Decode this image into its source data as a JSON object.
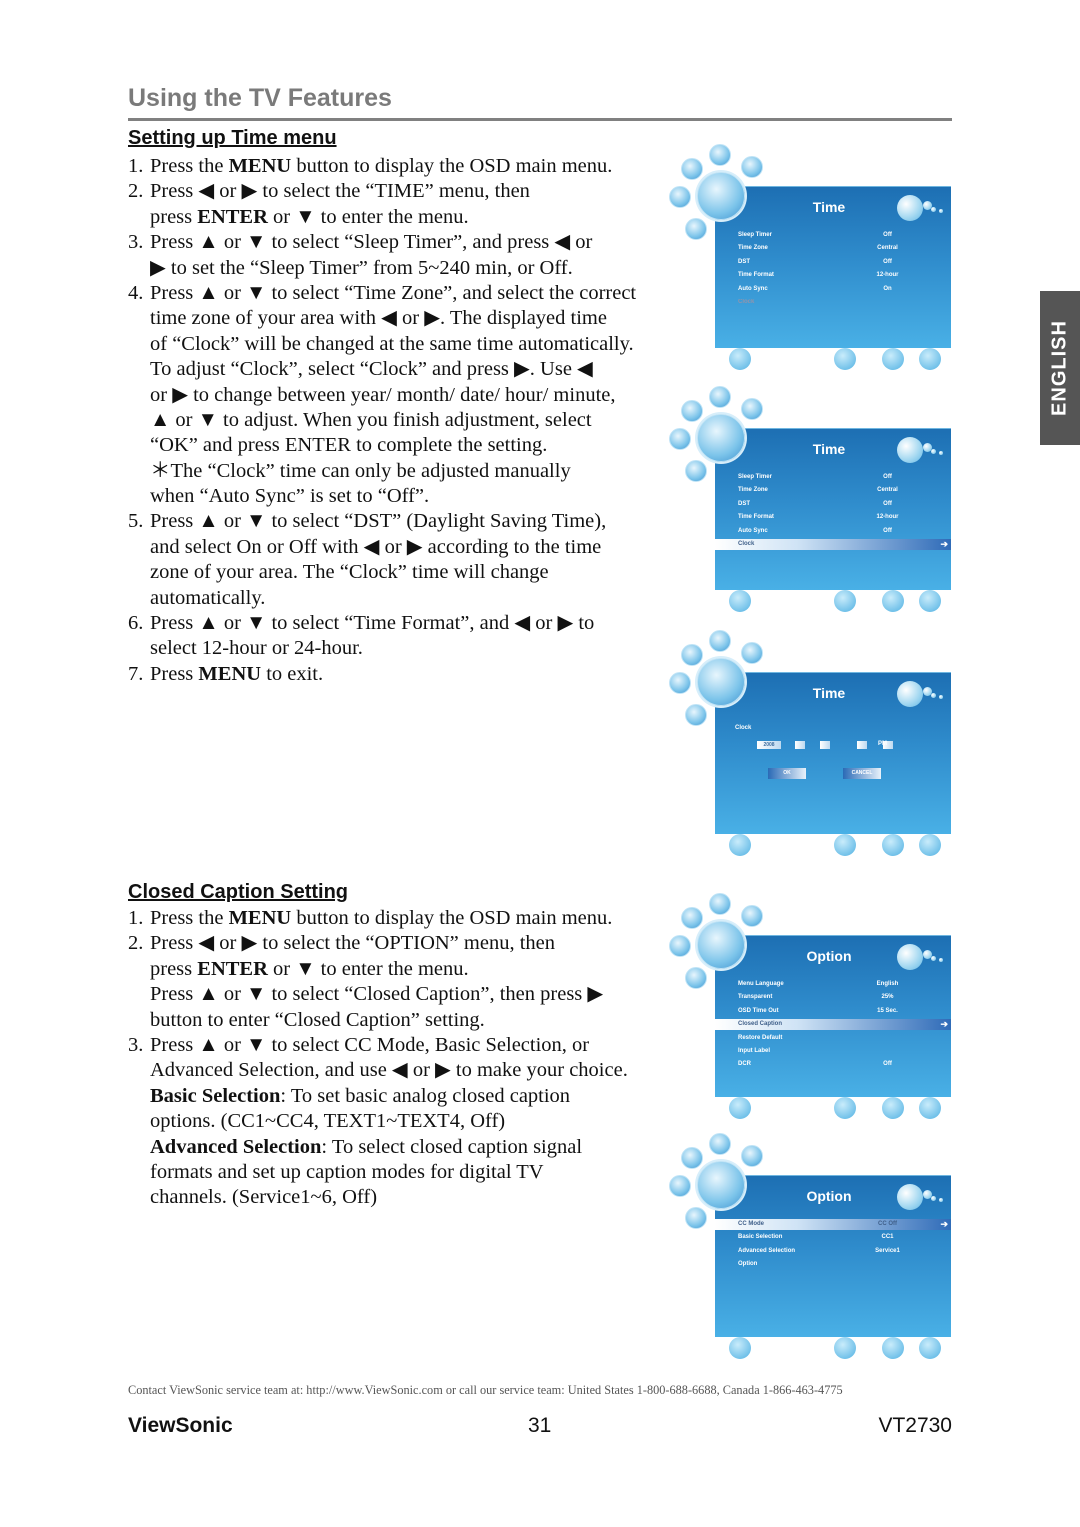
{
  "header": {
    "title": "Using the TV Features"
  },
  "side_tab": {
    "label": "ENGLISH"
  },
  "sections": [
    {
      "heading": "Setting up Time menu",
      "lines": [
        {
          "n": "1.",
          "s": [
            [
              "Press the ",
              0
            ],
            [
              "MENU",
              1
            ],
            [
              " button to display the OSD main menu.",
              0
            ]
          ]
        },
        {
          "n": "2.",
          "s": [
            [
              "Press ◀ or ▶ to select the “TIME” menu, then",
              0
            ]
          ]
        },
        {
          "n": "",
          "s": [
            [
              "press ",
              0
            ],
            [
              "ENTER",
              1
            ],
            [
              " or ▼ to enter the menu.",
              0
            ]
          ]
        },
        {
          "n": "3.",
          "s": [
            [
              "Press ▲ or ▼ to select “Sleep Timer”, and press ◀ or",
              0
            ]
          ]
        },
        {
          "n": "",
          "s": [
            [
              "▶ to set the “Sleep Timer” from 5~240 min, or Off.",
              0
            ]
          ]
        },
        {
          "n": "4.",
          "s": [
            [
              "Press ▲ or ▼ to select “Time Zone”, and select the correct",
              0
            ]
          ]
        },
        {
          "n": "",
          "s": [
            [
              "time zone of your area with ◀ or ▶. The displayed time",
              0
            ]
          ]
        },
        {
          "n": "",
          "s": [
            [
              "of “Clock” will be changed at the same time automatically.",
              0
            ]
          ]
        },
        {
          "n": "",
          "s": [
            [
              "To adjust “Clock”, select “Clock” and press ▶. Use ◀",
              0
            ]
          ]
        },
        {
          "n": "",
          "s": [
            [
              "or ▶ to change between year/ month/ date/ hour/ minute,",
              0
            ]
          ]
        },
        {
          "n": "",
          "s": [
            [
              "▲ or ▼ to adjust. When you finish adjustment, select",
              0
            ]
          ]
        },
        {
          "n": "",
          "s": [
            [
              "“OK” and press ENTER to complete the setting.",
              0
            ]
          ]
        },
        {
          "n": "",
          "s": [
            [
              "＊The “Clock” time can only be adjusted manually",
              0
            ]
          ]
        },
        {
          "n": "",
          "s": [
            [
              "when “Auto Sync” is set to “Off”.",
              0
            ]
          ]
        },
        {
          "n": "5.",
          "s": [
            [
              "Press ▲ or ▼ to select “DST” (Daylight Saving Time),",
              0
            ]
          ]
        },
        {
          "n": "",
          "s": [
            [
              "and select On or Off with ◀ or ▶ according to the time",
              0
            ]
          ]
        },
        {
          "n": "",
          "s": [
            [
              "zone of your area. The “Clock” time will change",
              0
            ]
          ]
        },
        {
          "n": "",
          "s": [
            [
              "automatically.",
              0
            ]
          ]
        },
        {
          "n": "6.",
          "s": [
            [
              "Press ▲ or ▼ to select “Time Format”, and ◀ or ▶ to",
              0
            ]
          ]
        },
        {
          "n": "",
          "s": [
            [
              "select 12-hour or 24-hour.",
              0
            ]
          ]
        },
        {
          "n": "7.",
          "s": [
            [
              "Press ",
              0
            ],
            [
              "MENU",
              1
            ],
            [
              " to exit.",
              0
            ]
          ]
        }
      ]
    },
    {
      "heading": "Closed Caption Setting",
      "lines": [
        {
          "n": "1.",
          "s": [
            [
              "Press the ",
              0
            ],
            [
              "MENU",
              1
            ],
            [
              " button to display the OSD main menu.",
              0
            ]
          ]
        },
        {
          "n": "2.",
          "s": [
            [
              "Press ◀ or ▶ to select the “OPTION” menu, then",
              0
            ]
          ]
        },
        {
          "n": "",
          "s": [
            [
              "press ",
              0
            ],
            [
              "ENTER",
              1
            ],
            [
              " or ▼ to enter the menu.",
              0
            ]
          ]
        },
        {
          "n": "",
          "s": [
            [
              "Press ▲ or ▼ to select “Closed Caption”, then press ▶",
              0
            ]
          ]
        },
        {
          "n": "",
          "s": [
            [
              "button to enter “Closed Caption” setting.",
              0
            ]
          ]
        },
        {
          "n": "3.",
          "s": [
            [
              "Press ▲ or ▼ to select CC Mode, Basic Selection, or",
              0
            ]
          ]
        },
        {
          "n": "",
          "s": [
            [
              "Advanced Selection, and use ◀ or ▶ to make your choice.",
              0
            ]
          ]
        },
        {
          "n": "",
          "s": [
            [
              "Basic Selection",
              1
            ],
            [
              ": To set basic analog closed caption",
              0
            ]
          ]
        },
        {
          "n": "",
          "s": [
            [
              "options. (CC1~CC4, TEXT1~TEXT4, Off)",
              0
            ]
          ]
        },
        {
          "n": "",
          "s": [
            [
              "Advanced Selection",
              1
            ],
            [
              ": To select closed caption signal",
              0
            ]
          ]
        },
        {
          "n": "",
          "s": [
            [
              "formats and set up caption modes for digital TV",
              0
            ]
          ]
        },
        {
          "n": "",
          "s": [
            [
              "channels. (Service1~6, Off)",
              0
            ]
          ]
        }
      ]
    }
  ],
  "osd_screens": [
    {
      "title": "Time",
      "rows": [
        {
          "label": "Sleep Timer",
          "value": "Off"
        },
        {
          "label": "Time Zone",
          "value": "Central"
        },
        {
          "label": "DST",
          "value": "Off"
        },
        {
          "label": "Time Format",
          "value": "12-hour"
        },
        {
          "label": "Auto Sync",
          "value": "On"
        },
        {
          "label": "Clock",
          "value": "",
          "state": "disabled"
        }
      ]
    },
    {
      "title": "Time",
      "rows": [
        {
          "label": "Sleep Timer",
          "value": "Off"
        },
        {
          "label": "Time Zone",
          "value": "Central"
        },
        {
          "label": "DST",
          "value": "Off"
        },
        {
          "label": "Time Format",
          "value": "12-hour"
        },
        {
          "label": "Auto Sync",
          "value": "Off"
        },
        {
          "label": "Clock",
          "value": "",
          "state": "highlighted"
        }
      ]
    },
    {
      "title": "Time",
      "clock": {
        "label": "Clock",
        "year": "2008",
        "ampm": "PM",
        "ok": "OK",
        "cancel": "CANCEL"
      }
    },
    {
      "title": "Option",
      "rows": [
        {
          "label": "Menu Language",
          "value": "English"
        },
        {
          "label": "Transparent",
          "value": "25%"
        },
        {
          "label": "OSD Time Out",
          "value": "15 Sec."
        },
        {
          "label": "Closed Caption",
          "value": "",
          "state": "highlighted"
        },
        {
          "label": "Restore Default",
          "value": ""
        },
        {
          "label": "Input Label",
          "value": ""
        },
        {
          "label": "DCR",
          "value": "Off"
        }
      ]
    },
    {
      "title": "Option",
      "rows": [
        {
          "label": "CC Mode",
          "value": "CC Off",
          "state": "highlighted"
        },
        {
          "label": "Basic Selection",
          "value": "CC1"
        },
        {
          "label": "Advanced Selection",
          "value": "Service1"
        },
        {
          "label": "Option",
          "value": ""
        }
      ]
    }
  ],
  "footer": {
    "contact": "Contact ViewSonic service team at: http://www.ViewSonic.com or call our service team: United States 1-800-688-6688, Canada 1-866-463-4775",
    "brand": "ViewSonic",
    "page_number": "31",
    "model": "VT2730"
  }
}
